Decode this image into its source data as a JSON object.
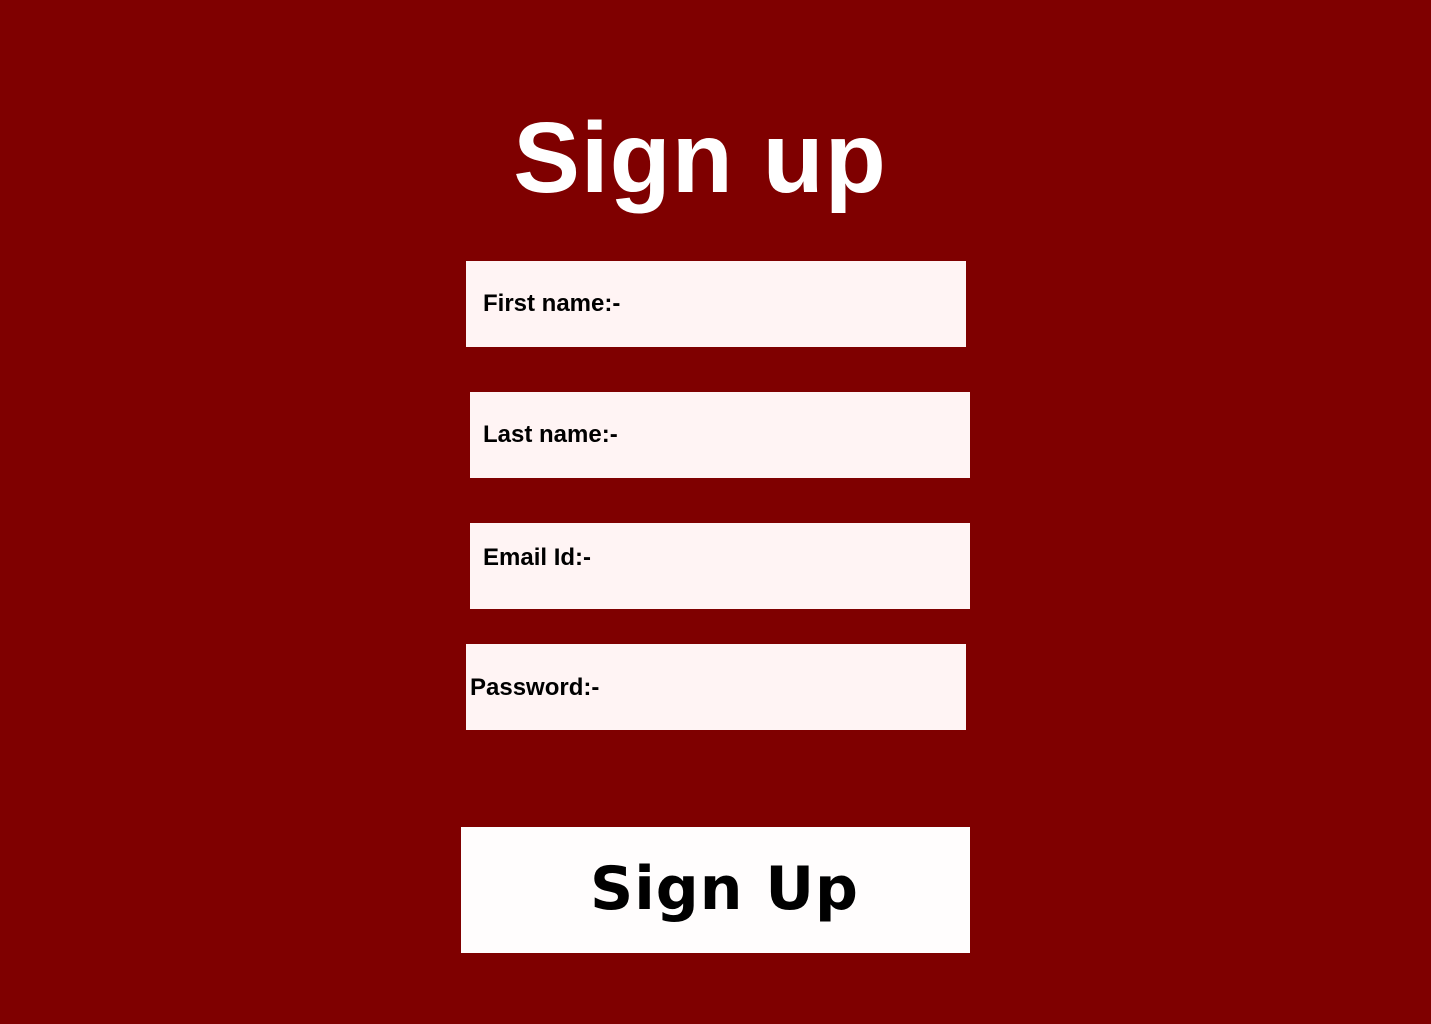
{
  "page": {
    "title": "Sign up",
    "background_color": "#7f0000",
    "field_color": "#fff4f4",
    "button_color": "#fffdfd"
  },
  "form": {
    "fields": [
      {
        "label": "First name:-",
        "value": ""
      },
      {
        "label": "Last name:-",
        "value": ""
      },
      {
        "label": "Email Id:-",
        "value": ""
      },
      {
        "label": "Password:-",
        "value": ""
      }
    ],
    "submit_label": "Sign Up"
  }
}
